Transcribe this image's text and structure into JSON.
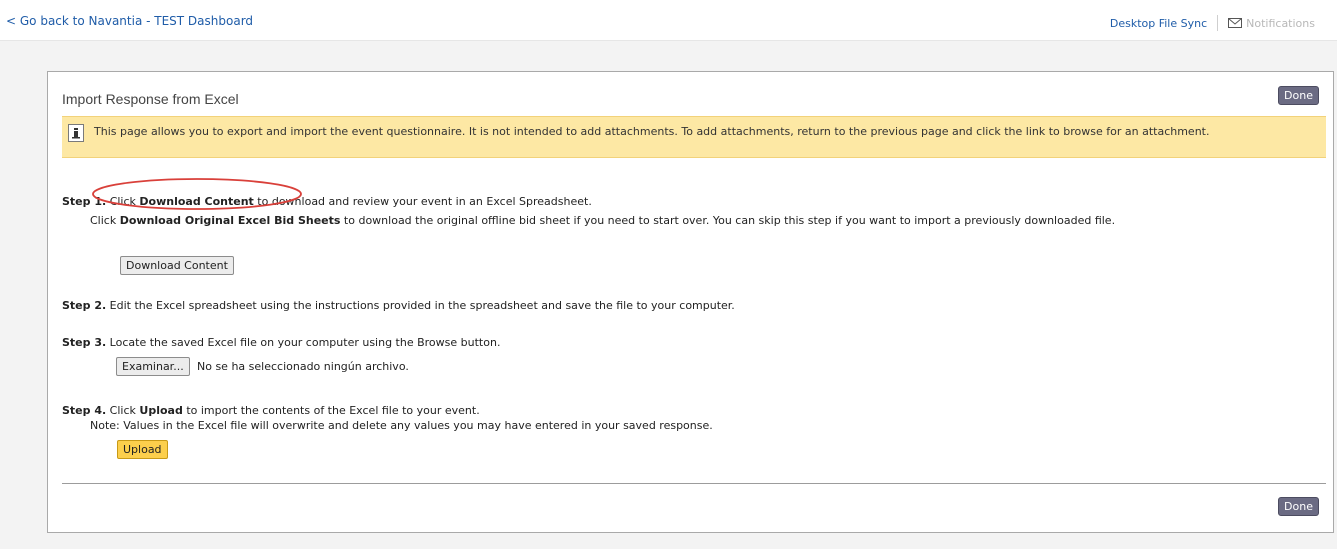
{
  "header": {
    "back_link": "< Go back to Navantia - TEST Dashboard",
    "desktop_sync": "Desktop File Sync",
    "notifications": "Notifications"
  },
  "panel": {
    "title": "Import Response from Excel",
    "done_label": "Done",
    "info_text": "This page allows you to export and import the event questionnaire. It is not intended to add attachments. To add attachments, return to the previous page and click the link to browse for an attachment."
  },
  "steps": {
    "step1": {
      "label": "Step 1.",
      "text_pre": "Click ",
      "bold": "Download Content",
      "text_post": " to download and review your event in an Excel Spreadsheet.",
      "sub_pre": "Click ",
      "sub_bold": "Download Original Excel Bid Sheets",
      "sub_post": " to download the original offline bid sheet if you need to start over. You can skip this step if you want to import a previously downloaded file.",
      "button": "Download Content"
    },
    "step2": {
      "label": "Step 2.",
      "text": " Edit the Excel spreadsheet using the instructions provided in the spreadsheet and save the file to your computer."
    },
    "step3": {
      "label": "Step 3.",
      "text": " Locate the saved Excel file on your computer using the Browse button.",
      "browse_button": "Examinar...",
      "file_status": "No se ha seleccionado ningún archivo."
    },
    "step4": {
      "label": "Step 4.",
      "text_pre": " Click ",
      "bold": "Upload",
      "text_post": " to import the contents of the Excel file to your event.",
      "note": "Note: Values in the Excel file will overwrite and delete any values you may have entered in your saved response.",
      "button": "Upload"
    }
  },
  "colors": {
    "link": "#1f5ca8",
    "info_bg": "#fde8a4",
    "upload_bg": "#fccf4c",
    "done_bg": "#6b6b83",
    "highlight": "#d9403a"
  },
  "icons": [
    "envelope-icon",
    "info-icon"
  ]
}
